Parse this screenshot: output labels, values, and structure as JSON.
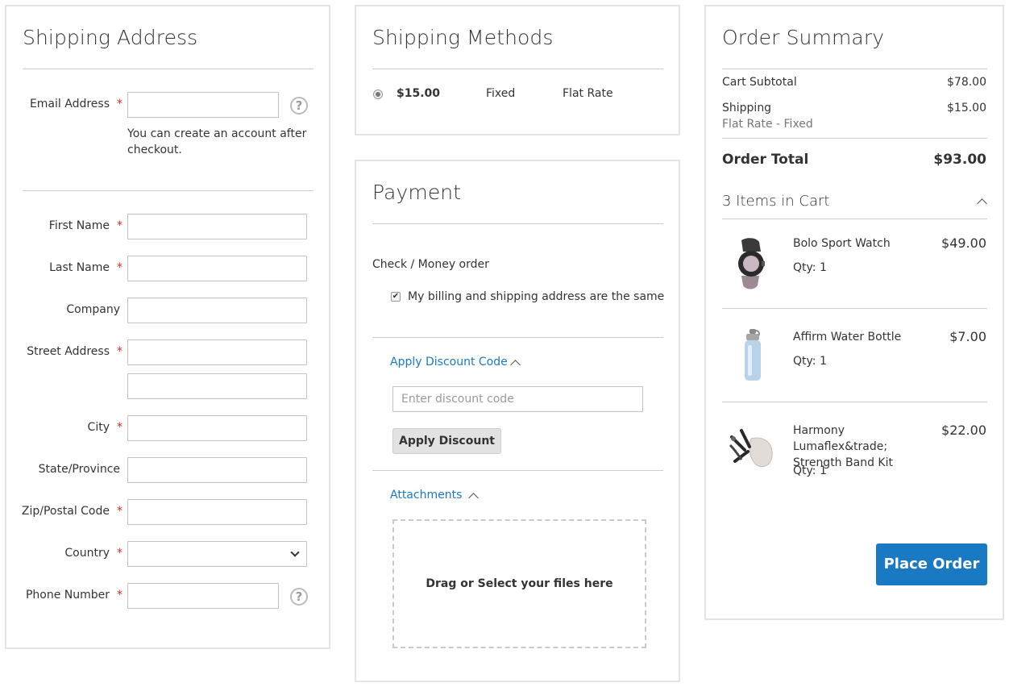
{
  "shipping_address": {
    "title": "Shipping Address",
    "email_label": "Email Address",
    "email_value": "",
    "email_note": "You can create an account after checkout.",
    "first_name_label": "First Name",
    "last_name_label": "Last Name",
    "company_label": "Company",
    "street_label": "Street Address",
    "city_label": "City",
    "state_label": "State/Province",
    "zip_label": "Zip/Postal Code",
    "country_label": "Country",
    "phone_label": "Phone Number",
    "required_mark": "*",
    "help_glyph": "?"
  },
  "shipping_methods": {
    "title": "Shipping Methods",
    "price": "$15.00",
    "method": "Fixed",
    "carrier": "Flat Rate"
  },
  "payment": {
    "title": "Payment",
    "method": "Check / Money order",
    "billing_same_label": "My billing and shipping address are the same",
    "discount_toggle": "Apply Discount Code",
    "discount_placeholder": "Enter discount code",
    "discount_button": "Apply Discount",
    "attachments_toggle": "Attachments",
    "dropzone_text": "Drag or Select your files here"
  },
  "order_summary": {
    "title": "Order Summary",
    "subtotal_label": "Cart Subtotal",
    "subtotal_value": "$78.00",
    "shipping_label": "Shipping",
    "shipping_value": "$15.00",
    "shipping_method": "Flat Rate - Fixed",
    "total_label": "Order Total",
    "total_value": "$93.00",
    "items_count_label": "3 Items in Cart",
    "items": [
      {
        "name": "Bolo Sport Watch",
        "qty": "Qty: 1",
        "price": "$49.00",
        "icon": "watch-icon"
      },
      {
        "name": "Affirm Water Bottle",
        "qty": "Qty: 1",
        "price": "$7.00",
        "icon": "bottle-icon"
      },
      {
        "name": "Harmony Lumaflex&trade; Strength Band Kit",
        "qty": "Qty: 1",
        "price": "$22.00",
        "icon": "band-kit-icon"
      }
    ],
    "place_order": "Place Order"
  },
  "colors": {
    "accent": "#1979c3",
    "required": "#e02b27",
    "border": "#e4e4e4"
  }
}
